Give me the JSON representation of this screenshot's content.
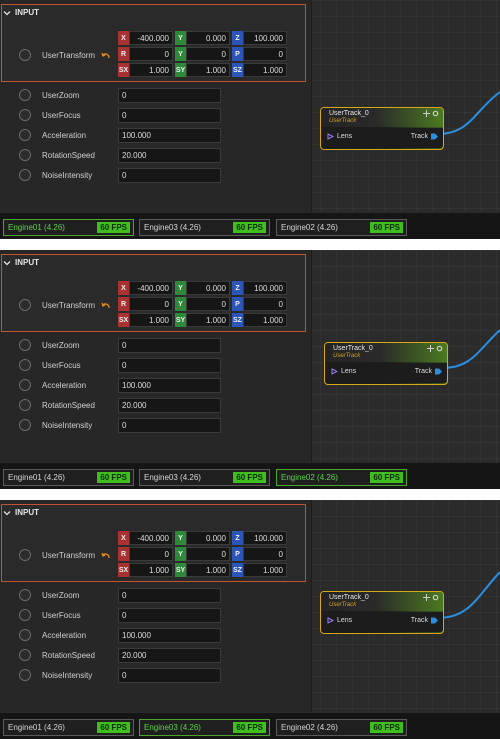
{
  "panels": [
    {
      "section_label": "INPUT",
      "transform_label": "UserTransform",
      "transform": {
        "row1": [
          {
            "axis": "X",
            "value": "-400.000"
          },
          {
            "axis": "Y",
            "value": "0.000"
          },
          {
            "axis": "Z",
            "value": "100.000"
          }
        ],
        "row2": [
          {
            "axis": "R",
            "value": "0"
          },
          {
            "axis": "Y",
            "value": "0"
          },
          {
            "axis": "P",
            "value": "0"
          }
        ],
        "row3": [
          {
            "axis": "SX",
            "value": "1.000"
          },
          {
            "axis": "SY",
            "value": "1.000"
          },
          {
            "axis": "SZ",
            "value": "1.000"
          }
        ]
      },
      "properties": [
        {
          "label": "UserZoom",
          "value": "0"
        },
        {
          "label": "UserFocus",
          "value": "0"
        },
        {
          "label": "Acceleration",
          "value": "100.000"
        },
        {
          "label": "RotationSpeed",
          "value": "20.000"
        },
        {
          "label": "NoiseIntensity",
          "value": "0"
        }
      ],
      "node": {
        "title": "UserTrack_0",
        "subtitle": "UserTrack",
        "input_pin": "Lens",
        "output_pin": "Track"
      },
      "engines": [
        {
          "name": "Engine01 (4.26)",
          "fps": "60 FPS",
          "active": true
        },
        {
          "name": "Engine03 (4.26)",
          "fps": "60 FPS",
          "active": false
        },
        {
          "name": "Engine02 (4.26)",
          "fps": "60 FPS",
          "active": false
        }
      ]
    },
    {
      "section_label": "INPUT",
      "transform_label": "UserTransform",
      "transform": {
        "row1": [
          {
            "axis": "X",
            "value": "-400.000"
          },
          {
            "axis": "Y",
            "value": "0.000"
          },
          {
            "axis": "Z",
            "value": "100.000"
          }
        ],
        "row2": [
          {
            "axis": "R",
            "value": "0"
          },
          {
            "axis": "Y",
            "value": "0"
          },
          {
            "axis": "P",
            "value": "0"
          }
        ],
        "row3": [
          {
            "axis": "SX",
            "value": "1.000"
          },
          {
            "axis": "SY",
            "value": "1.000"
          },
          {
            "axis": "SZ",
            "value": "1.000"
          }
        ]
      },
      "properties": [
        {
          "label": "UserZoom",
          "value": "0"
        },
        {
          "label": "UserFocus",
          "value": "0"
        },
        {
          "label": "Acceleration",
          "value": "100.000"
        },
        {
          "label": "RotationSpeed",
          "value": "20.000"
        },
        {
          "label": "NoiseIntensity",
          "value": "0"
        }
      ],
      "node": {
        "title": "UserTrack_0",
        "subtitle": "UserTrack",
        "input_pin": "Lens",
        "output_pin": "Track"
      },
      "engines": [
        {
          "name": "Engine01 (4.26)",
          "fps": "60 FPS",
          "active": false
        },
        {
          "name": "Engine03 (4.26)",
          "fps": "60 FPS",
          "active": false
        },
        {
          "name": "Engine02 (4.26)",
          "fps": "60 FPS",
          "active": true
        }
      ]
    },
    {
      "section_label": "INPUT",
      "transform_label": "UserTransform",
      "transform": {
        "row1": [
          {
            "axis": "X",
            "value": "-400.000"
          },
          {
            "axis": "Y",
            "value": "0.000"
          },
          {
            "axis": "Z",
            "value": "100.000"
          }
        ],
        "row2": [
          {
            "axis": "R",
            "value": "0"
          },
          {
            "axis": "Y",
            "value": "0"
          },
          {
            "axis": "P",
            "value": "0"
          }
        ],
        "row3": [
          {
            "axis": "SX",
            "value": "1.000"
          },
          {
            "axis": "SY",
            "value": "1.000"
          },
          {
            "axis": "SZ",
            "value": "1.000"
          }
        ]
      },
      "properties": [
        {
          "label": "UserZoom",
          "value": "0"
        },
        {
          "label": "UserFocus",
          "value": "0"
        },
        {
          "label": "Acceleration",
          "value": "100.000"
        },
        {
          "label": "RotationSpeed",
          "value": "20.000"
        },
        {
          "label": "NoiseIntensity",
          "value": "0"
        }
      ],
      "node": {
        "title": "UserTrack_0",
        "subtitle": "UserTrack",
        "input_pin": "Lens",
        "output_pin": "Track"
      },
      "engines": [
        {
          "name": "Engine01 (4.26)",
          "fps": "60 FPS",
          "active": false
        },
        {
          "name": "Engine03 (4.26)",
          "fps": "60 FPS",
          "active": true
        },
        {
          "name": "Engine02 (4.26)",
          "fps": "60 FPS",
          "active": false
        }
      ]
    }
  ],
  "colors": {
    "accent_orange": "#c2552e",
    "node_border": "#d8a818",
    "fps_green": "#3fbe1e",
    "wire_blue": "#2a8fe0"
  }
}
